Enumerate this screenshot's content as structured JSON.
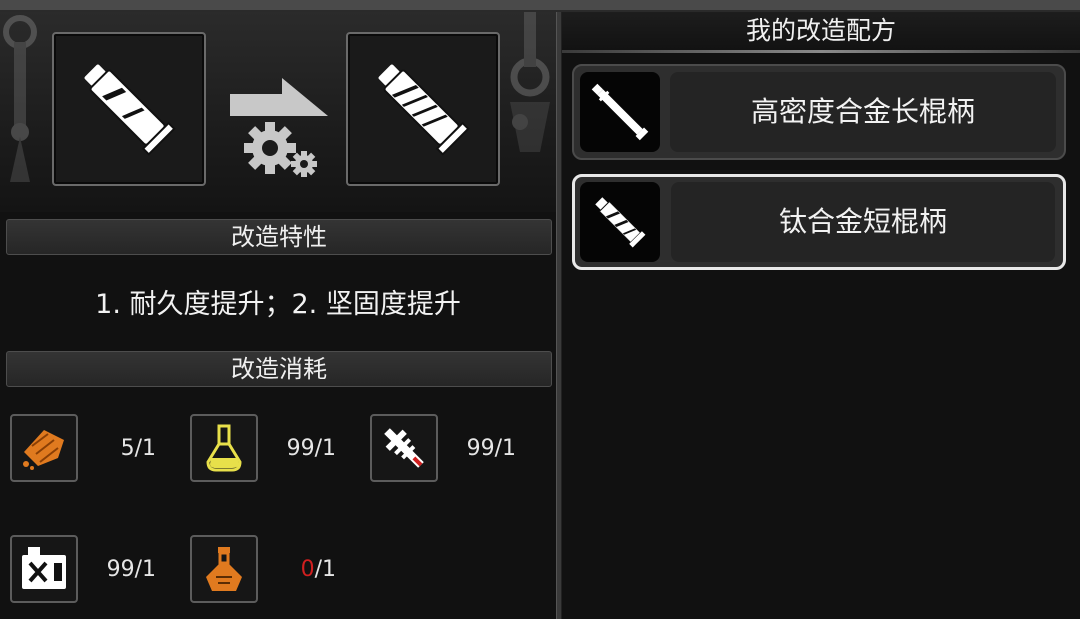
{
  "left_panel": {
    "source_item_icon": "white-handle-tube-icon",
    "target_item_icon": "striped-handle-tube-icon",
    "transform_icon": "arrow-gears-icon",
    "traits_header": "改造特性",
    "traits_text": "1. 耐久度提升；2. 坚固度提升",
    "cost_header": "改造消耗",
    "materials": [
      {
        "icon": "orange-ingot-icon",
        "have": "5",
        "need": "/1",
        "low": false
      },
      {
        "icon": "yellow-flask-icon",
        "have": "99",
        "need": "/1",
        "low": false
      },
      {
        "icon": "gear-shaft-icon",
        "have": "99",
        "need": "/1",
        "low": false
      },
      {
        "icon": "fuel-canister-icon",
        "have": "99",
        "need": "/1",
        "low": false
      },
      {
        "icon": "orange-potion-icon",
        "have": "0",
        "need": "/1",
        "low": true
      }
    ]
  },
  "right_panel": {
    "title": "我的改造配方",
    "recipes": [
      {
        "name": "高密度合金长棍柄",
        "icon": "long-rod-icon",
        "selected": false
      },
      {
        "name": "钛合金短棍柄",
        "icon": "short-rod-icon",
        "selected": true
      }
    ]
  },
  "colors": {
    "background": "#111111",
    "insufficient": "#d01f1f",
    "accent_orange": "#e07a1f",
    "accent_yellow": "#e8e04a"
  }
}
